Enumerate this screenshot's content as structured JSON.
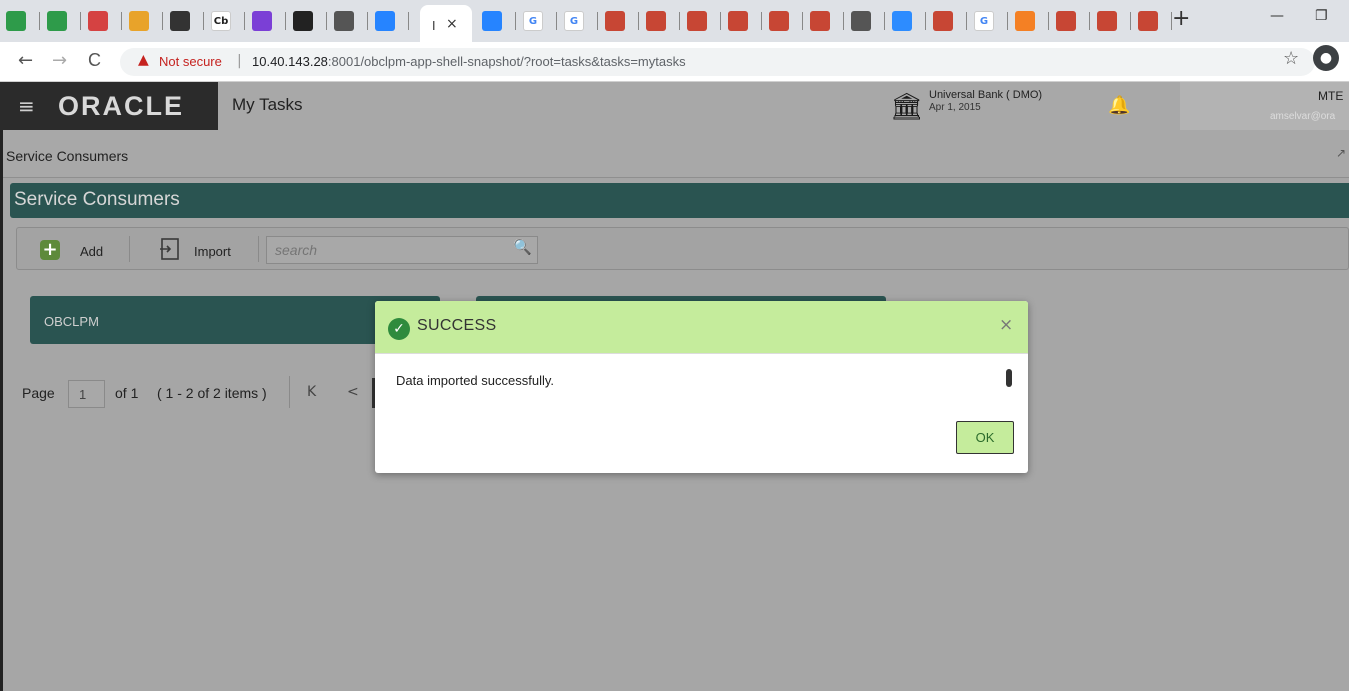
{
  "browser": {
    "tabs": [
      {
        "icon": "image-icon",
        "color": "#2e9b4a"
      },
      {
        "icon": "image-icon",
        "color": "#2e9b4a"
      },
      {
        "icon": "book-icon",
        "color": "#d54242"
      },
      {
        "icon": "asterisk-icon",
        "color": "#e8a32a"
      },
      {
        "icon": "terminal-icon",
        "color": "#333333"
      },
      {
        "icon": "cb-icon",
        "label": "Cb",
        "color": "#222222"
      },
      {
        "icon": "play-icon",
        "color": "#7b3fd6"
      },
      {
        "icon": "github-icon",
        "color": "#222222"
      },
      {
        "icon": "globe-icon",
        "color": "#555555"
      },
      {
        "icon": "confluence-icon",
        "color": "#2684ff"
      }
    ],
    "active_tab": {
      "title": "I",
      "close": "×"
    },
    "right_tabs": [
      {
        "icon": "confluence-icon",
        "color": "#2684ff"
      },
      {
        "icon": "google-icon",
        "label": "G",
        "color": "#4285f4"
      },
      {
        "icon": "google-icon",
        "label": "G",
        "color": "#4285f4"
      },
      {
        "icon": "oracle-icon",
        "color": "#c74634"
      },
      {
        "icon": "oracle-icon",
        "color": "#c74634"
      },
      {
        "icon": "oracle-icon",
        "color": "#c74634"
      },
      {
        "icon": "oracle-icon",
        "color": "#c74634"
      },
      {
        "icon": "oracle-icon",
        "color": "#c74634"
      },
      {
        "icon": "oracle-icon",
        "color": "#c74634"
      },
      {
        "icon": "globe-icon",
        "color": "#555555"
      },
      {
        "icon": "zoom-icon",
        "color": "#2d8cff"
      },
      {
        "icon": "oracle-icon",
        "color": "#c74634"
      },
      {
        "icon": "google-icon",
        "label": "G",
        "color": "#4285f4"
      },
      {
        "icon": "stackoverflow-icon",
        "color": "#f48024"
      },
      {
        "icon": "oracle-icon",
        "color": "#c74634"
      },
      {
        "icon": "oracle-icon",
        "color": "#c74634"
      },
      {
        "icon": "oracle-icon",
        "color": "#c74634"
      }
    ],
    "new_tab": "+",
    "minimize": "—",
    "restore": "❐",
    "nav_back": "←",
    "nav_forward": "→",
    "reload": "C",
    "not_secure": "Not secure",
    "separator": "|",
    "url_host": "10.40.143.28",
    "url_rest": ":8001/obclpm-app-shell-snapshot/?root=tasks&tasks=mytasks",
    "star": "☆"
  },
  "app_header": {
    "hamburger": "≡",
    "logo": "ORACLE",
    "title": "My Tasks",
    "bank_name": "Universal Bank ( DMO)",
    "bank_date": "Apr 1, 2015",
    "user_name": "MTE",
    "user_email": "amselvar@ora"
  },
  "breadcrumb": "Service Consumers",
  "panel_title": "Service Consumers",
  "toolbar": {
    "add_label": "Add",
    "import_label": "Import",
    "search_placeholder": "search"
  },
  "cards": [
    {
      "label": "OBCLPM"
    },
    {
      "label": ""
    }
  ],
  "pager": {
    "page_label": "Page",
    "page_value": "1",
    "of_label": "of 1",
    "items_label": "( 1 - 2 of 2 items )",
    "first": "K",
    "prev": "<"
  },
  "modal": {
    "title": "SUCCESS",
    "close": "×",
    "message": "Data imported successfully.",
    "ok_label": "OK"
  },
  "colors": {
    "header_dark": "#2b2b2b",
    "panel_teal": "#2a5451",
    "success_green": "#c5ec9c",
    "check_green": "#2f8b3d"
  }
}
